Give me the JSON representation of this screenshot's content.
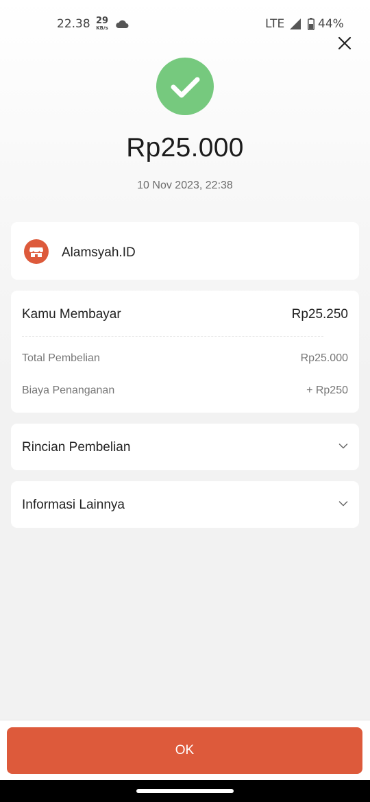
{
  "status_bar": {
    "time": "22.38",
    "net_speed_value": "29",
    "net_speed_unit": "KB/s",
    "cloud_icon": "cloud-icon",
    "network": "LTE",
    "signal_icon": "signal-icon",
    "battery_icon": "battery-icon",
    "battery": "44%"
  },
  "header": {
    "close_icon": "close-icon",
    "success_icon": "check-circle-icon",
    "success_color": "#76c97e",
    "amount": "Rp25.000",
    "datetime": "10 Nov 2023, 22:38"
  },
  "merchant": {
    "icon": "store-icon",
    "name": "Alamsyah.ID"
  },
  "payment": {
    "label": "Kamu Membayar",
    "value": "Rp25.250",
    "rows": [
      {
        "label": "Total Pembelian",
        "value": "Rp25.000"
      },
      {
        "label": "Biaya Penanganan",
        "value": "+ Rp250"
      }
    ]
  },
  "sections": [
    {
      "label": "Rincian Pembelian",
      "icon": "chevron-down-icon"
    },
    {
      "label": "Informasi Lainnya",
      "icon": "chevron-down-icon"
    }
  ],
  "footer": {
    "ok_label": "OK",
    "accent_color": "#dd5a3b"
  }
}
